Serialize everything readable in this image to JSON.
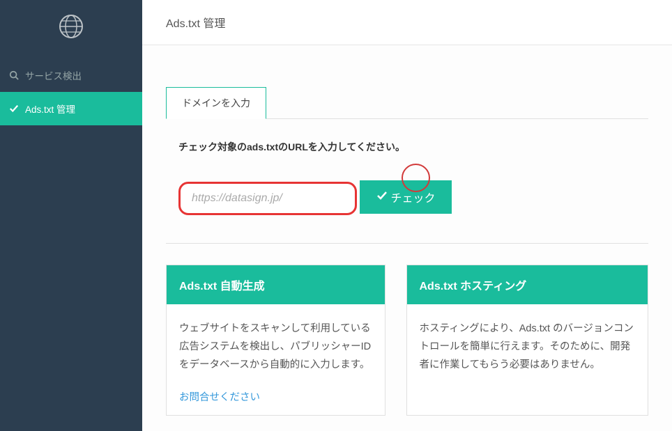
{
  "header": {
    "title": "Ads.txt 管理"
  },
  "sidebar": {
    "items": [
      {
        "label": "サービス検出"
      },
      {
        "label": "Ads.txt 管理"
      }
    ]
  },
  "form": {
    "tab_label": "ドメインを入力",
    "prompt": "チェック対象のads.txtのURLを入力してください。",
    "placeholder": "https://datasign.jp/",
    "button_label": "チェック"
  },
  "cards": [
    {
      "title": "Ads.txt 自動生成",
      "body": "ウェブサイトをスキャンして利用している広告システムを検出し、パブリッシャーIDをデータベースから自動的に入力します。",
      "link": "お問合せください"
    },
    {
      "title": "Ads.txt ホスティング",
      "body": "ホスティングにより、Ads.txt のバージョンコントロールを簡単に行えます。そのために、開発者に作業してもらう必要はありません。"
    }
  ]
}
